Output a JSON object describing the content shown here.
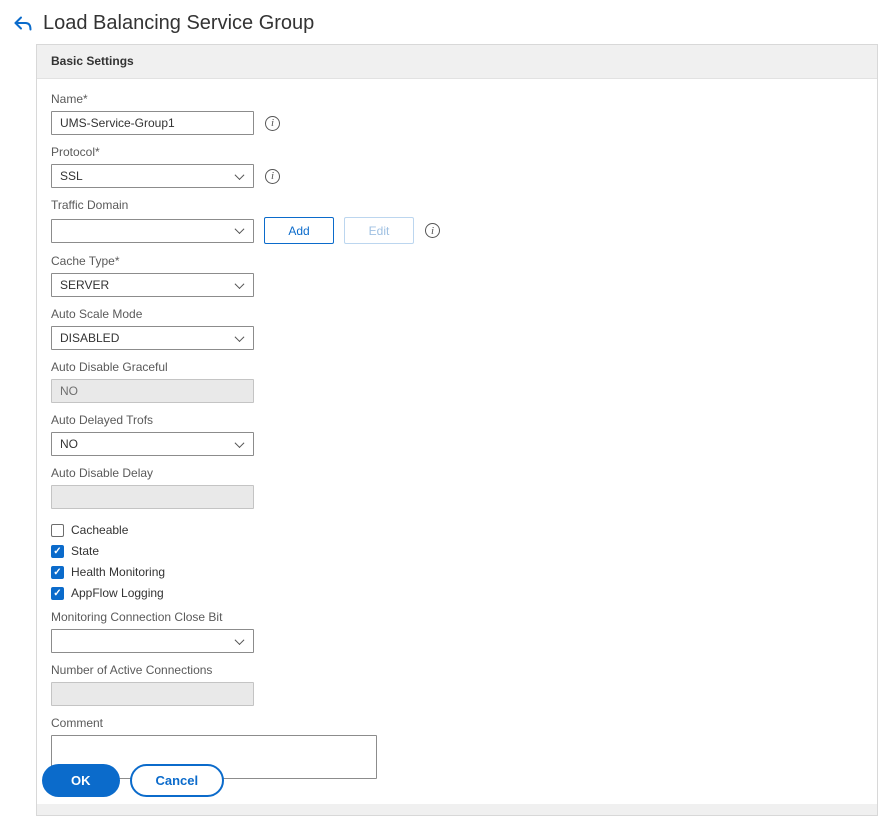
{
  "header": {
    "title": "Load Balancing Service Group"
  },
  "panel_title": "Basic Settings",
  "fields": {
    "name": {
      "label": "Name*",
      "value": "UMS-Service-Group1"
    },
    "protocol": {
      "label": "Protocol*",
      "value": "SSL"
    },
    "traffic_domain": {
      "label": "Traffic Domain",
      "value": ""
    },
    "cache_type": {
      "label": "Cache Type*",
      "value": "SERVER"
    },
    "auto_scale_mode": {
      "label": "Auto Scale Mode",
      "value": "DISABLED"
    },
    "auto_disable_graceful": {
      "label": "Auto Disable Graceful",
      "value": "NO"
    },
    "auto_delayed_trofs": {
      "label": "Auto Delayed Trofs",
      "value": "NO"
    },
    "auto_disable_delay": {
      "label": "Auto Disable Delay",
      "value": ""
    },
    "monitoring_connection_close_bit": {
      "label": "Monitoring Connection Close Bit",
      "value": ""
    },
    "number_of_active_connections": {
      "label": "Number of Active Connections",
      "value": ""
    },
    "comment": {
      "label": "Comment",
      "value": ""
    }
  },
  "checkboxes": [
    {
      "label": "Cacheable",
      "checked": false
    },
    {
      "label": "State",
      "checked": true
    },
    {
      "label": "Health Monitoring",
      "checked": true
    },
    {
      "label": "AppFlow Logging",
      "checked": true
    }
  ],
  "buttons": {
    "add": "Add",
    "edit": "Edit",
    "ok": "OK",
    "cancel": "Cancel"
  },
  "colors": {
    "accent": "#0b6bcb",
    "panel_header_bg": "#f0f0f0",
    "disabled_input_bg": "#e9e9e9",
    "border": "#8c8c8c"
  }
}
